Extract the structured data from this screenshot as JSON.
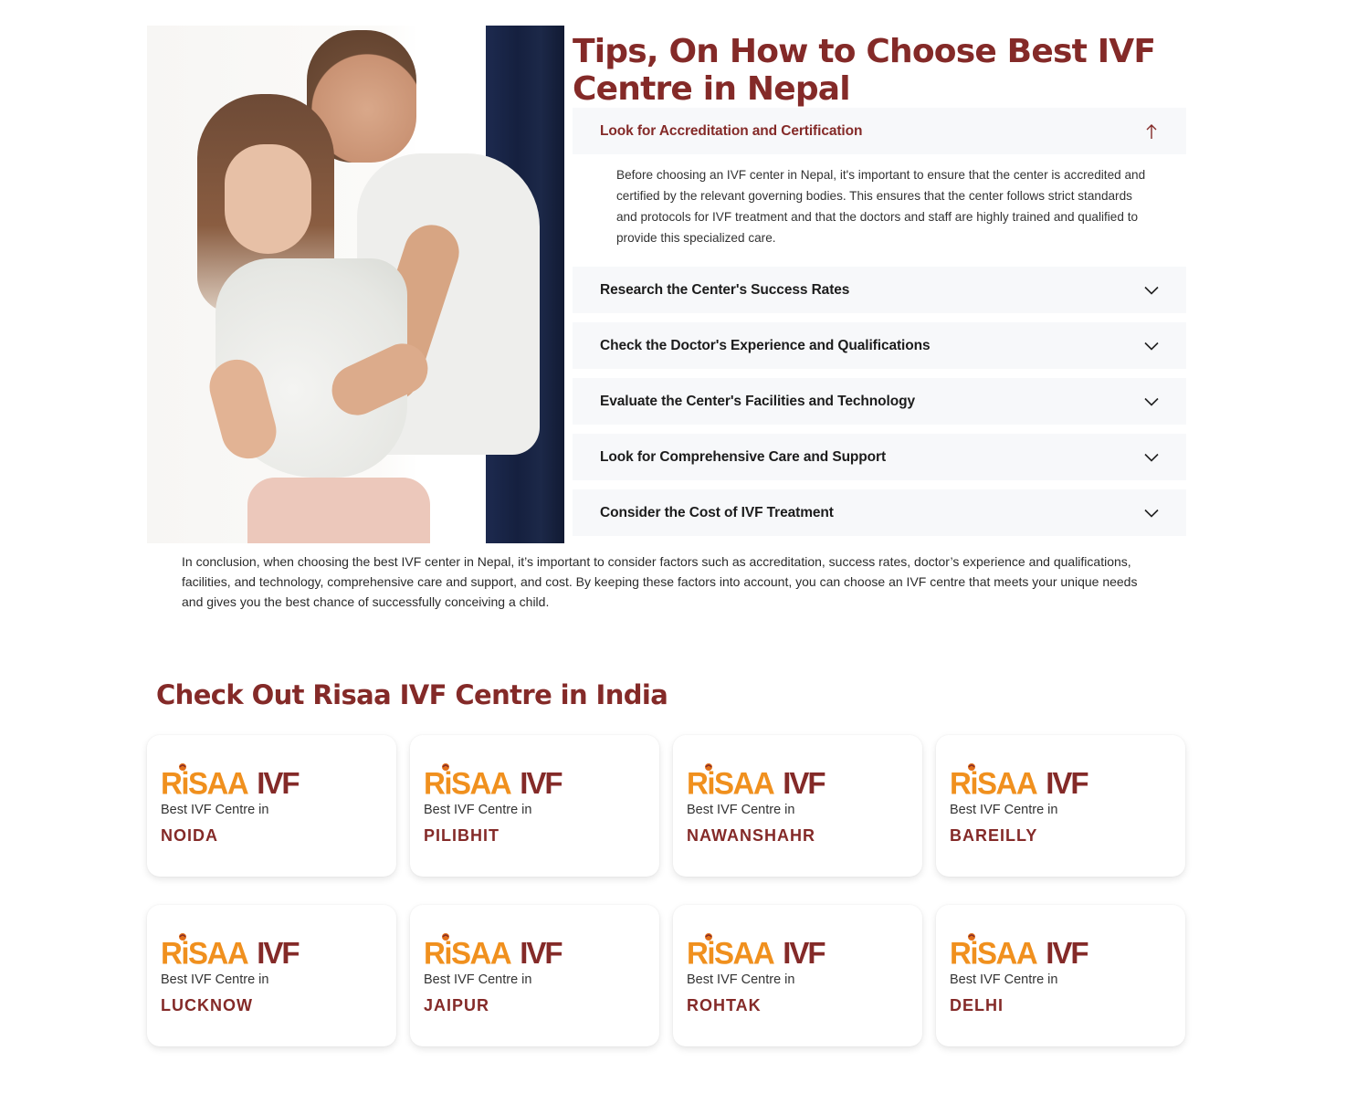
{
  "hero": {
    "image_alt": "Couple embracing, woman pregnant"
  },
  "tips": {
    "title": "Tips, On How to Choose Best IVF Centre in Nepal",
    "accordion": [
      {
        "title": "Look for Accreditation and Certification",
        "expanded": true,
        "icon": "arrow-up-icon",
        "body": "Before choosing an IVF center in Nepal, it's important to ensure that the center is accredited and certified by the relevant governing bodies. This ensures that the center follows strict standards and protocols for IVF treatment and that the doctors and staff are highly trained and qualified to provide this specialized care."
      },
      {
        "title": "Research the Center's Success Rates",
        "expanded": false,
        "icon": "chevron-down-icon"
      },
      {
        "title": "Check the Doctor's Experience and Qualifications",
        "expanded": false,
        "icon": "chevron-down-icon"
      },
      {
        "title": "Evaluate the Center's Facilities and Technology",
        "expanded": false,
        "icon": "chevron-down-icon"
      },
      {
        "title": "Look for Comprehensive Care and Support",
        "expanded": false,
        "icon": "chevron-down-icon"
      },
      {
        "title": "Consider the Cost of IVF Treatment",
        "expanded": false,
        "icon": "chevron-down-icon"
      }
    ],
    "conclusion": "In conclusion, when choosing the best IVF center in Nepal, it’s important to consider factors such as accreditation, success rates, doctor’s experience and qualifications, facilities, and technology, comprehensive care and support, and cost. By keeping these factors into account, you can choose an IVF centre that meets your unique needs and gives you the best chance of successfully conceiving a child."
  },
  "centres": {
    "title": "Check Out Risaa IVF Centre in India",
    "logo": {
      "brand": "RiSAA",
      "suffix": "IVF"
    },
    "subtitle": "Best IVF Centre in",
    "cities": [
      "NOIDA",
      "PILIBHIT",
      "NAWANSHAHR",
      "BAREILLY",
      "LUCKNOW",
      "JAIPUR",
      "ROHTAK",
      "DELHI"
    ]
  },
  "colors": {
    "brand_maroon": "#842a28",
    "brand_orange": "#f0901e",
    "accordion_bg": "#f7f8fa"
  }
}
